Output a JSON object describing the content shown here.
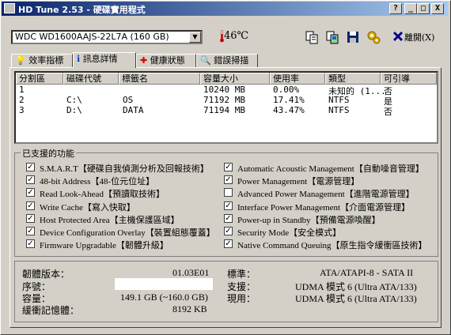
{
  "window": {
    "title": "HD Tune 2.53 - 硬碟實用程式",
    "controls": [
      "?",
      "_",
      "□",
      "X"
    ]
  },
  "toolbar": {
    "drive": "WDC WD1600AAJS-22L7A (160 GB)",
    "temperature": "46℃",
    "exit_label": "離開(X)",
    "icons": [
      "copy-text-icon",
      "copy-screen-icon",
      "save-icon",
      "options-icon",
      "exit-icon"
    ]
  },
  "tabs": [
    {
      "label": "效率指標",
      "icon": "benchmark-icon"
    },
    {
      "label": "訊息詳情",
      "icon": "info-icon",
      "active": true
    },
    {
      "label": "健康狀態",
      "icon": "health-icon"
    },
    {
      "label": "錯誤掃描",
      "icon": "scan-icon"
    }
  ],
  "partitions": {
    "columns": [
      "分割區",
      "磁碟代號",
      "標籤名",
      "容量大小",
      "使用率",
      "類型",
      "可引導"
    ],
    "rows": [
      [
        "1",
        "",
        "",
        "10240 MB",
        "0.00%",
        "未知的 (1...",
        "否"
      ],
      [
        "2",
        "C:\\",
        "OS",
        "71192 MB",
        "17.41%",
        "NTFS",
        "是"
      ],
      [
        "3",
        "D:\\",
        "DATA",
        "71194 MB",
        "43.47%",
        "NTFS",
        "否"
      ]
    ]
  },
  "features": {
    "title": "已支援的功能",
    "left": [
      {
        "label": "S.M.A.R.T【硬碟自我偵測分析及回報技術】",
        "checked": true
      },
      {
        "label": "48-bit Address【48-位元位址】",
        "checked": true
      },
      {
        "label": "Read Look-Ahead【預讀取技術】",
        "checked": true
      },
      {
        "label": "Write Cache【寫入快取】",
        "checked": true
      },
      {
        "label": "Host Protected Area【主機保護區域】",
        "checked": true
      },
      {
        "label": "Device Configuration Overlay【裝置組態覆蓋】",
        "checked": true
      },
      {
        "label": "Firmware Upgradable【韌體升級】",
        "checked": true
      }
    ],
    "right": [
      {
        "label": "Automatic Acoustic Management【自動噪音管理】",
        "checked": true
      },
      {
        "label": "Power Management【電源管理】",
        "checked": true
      },
      {
        "label": "Advanced Power Management【進階電源管理】",
        "checked": false
      },
      {
        "label": "Interface Power Management【介面電源管理】",
        "checked": true
      },
      {
        "label": "Power-up in Standby【預備電源喚醒】",
        "checked": true
      },
      {
        "label": "Security Mode【安全模式】",
        "checked": true
      },
      {
        "label": "Native Command Queuing【原生指令緩衝區技術】",
        "checked": true
      }
    ]
  },
  "info": {
    "firmware_label": "韌體版本：",
    "firmware": "01.03E01",
    "serial_label": "序號：",
    "serial": "",
    "capacity_label": "容量：",
    "capacity": "149.1 GB (~160.0 GB)",
    "buffer_label": "緩衝記憶體：",
    "buffer": "8192 KB",
    "standard_label": "標準：",
    "standard": "ATA/ATAPI-8 - SATA II",
    "supported_label": "支援：",
    "supported": "UDMA 模式 6 (Ultra ATA/133)",
    "current_label": "現用：",
    "current": "UDMA 模式 6 (Ultra ATA/133)"
  }
}
